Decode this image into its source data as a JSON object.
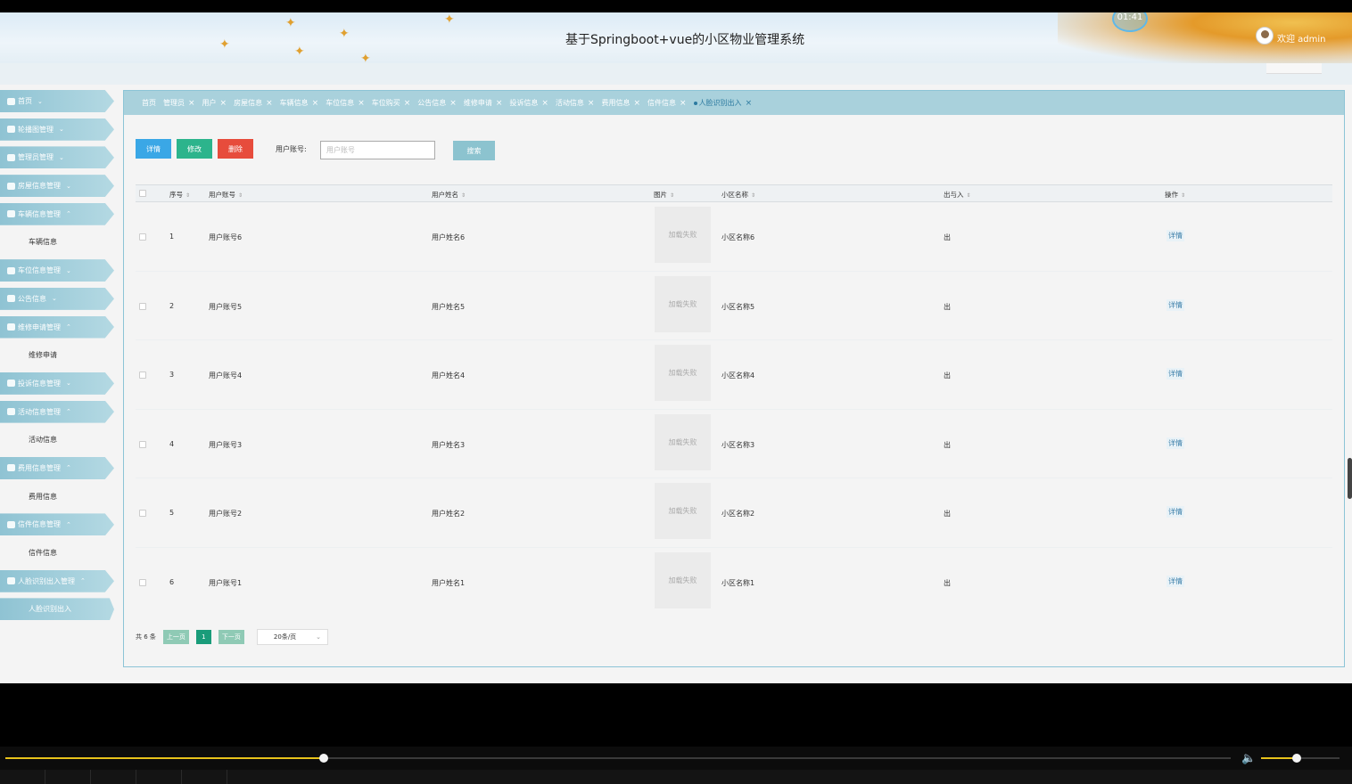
{
  "app": {
    "title": "基于Springboot+vue的小区物业管理系统",
    "clock": "01:41",
    "welcome": "欢迎 admin"
  },
  "colors": {
    "sidebar": "#8fc3d3",
    "tabbar": "#a9d1dc",
    "btn_detail": "#3aa7e6",
    "btn_edit": "#2cb48c",
    "btn_delete": "#e74c3c",
    "btn_search": "#8cc3cf",
    "pager_active": "#1a9c7a",
    "seek": "#e7c21a"
  },
  "sidebar": {
    "items": [
      {
        "type": "menu",
        "label": "首页",
        "icon": "home-icon",
        "arrow": "⌄"
      },
      {
        "type": "menu",
        "label": "轮播图管理",
        "icon": "carousel-icon",
        "arrow": "⌄"
      },
      {
        "type": "menu",
        "label": "管理员管理",
        "icon": "admin-icon",
        "arrow": "⌄"
      },
      {
        "type": "menu",
        "label": "房屋信息管理",
        "icon": "house-icon",
        "arrow": "⌄"
      },
      {
        "type": "menu",
        "label": "车辆信息管理",
        "icon": "car-icon",
        "arrow": "⌃"
      },
      {
        "type": "sub",
        "label": "车辆信息"
      },
      {
        "type": "menu",
        "label": "车位信息管理",
        "icon": "parking-icon",
        "arrow": "⌄"
      },
      {
        "type": "menu",
        "label": "公告信息",
        "icon": "grid-icon",
        "arrow": "⌄"
      },
      {
        "type": "menu",
        "label": "维修申请管理",
        "icon": "repair-icon",
        "arrow": "⌃"
      },
      {
        "type": "sub",
        "label": "维修申请"
      },
      {
        "type": "menu",
        "label": "投诉信息管理",
        "icon": "complaint-icon",
        "arrow": "⌄"
      },
      {
        "type": "menu",
        "label": "活动信息管理",
        "icon": "activity-icon",
        "arrow": "⌃"
      },
      {
        "type": "sub",
        "label": "活动信息"
      },
      {
        "type": "menu",
        "label": "费用信息管理",
        "icon": "fee-icon",
        "arrow": "⌃"
      },
      {
        "type": "sub",
        "label": "费用信息"
      },
      {
        "type": "menu",
        "label": "信件信息管理",
        "icon": "mail-icon",
        "arrow": "⌃"
      },
      {
        "type": "sub",
        "label": "信件信息"
      },
      {
        "type": "menu",
        "label": "人脸识别出入管理",
        "icon": "face-icon",
        "arrow": "⌃"
      },
      {
        "type": "sub",
        "label": "人脸识别出入",
        "active": true
      }
    ]
  },
  "tabs": [
    {
      "label": "首页",
      "closable": false
    },
    {
      "label": "管理员",
      "closable": true
    },
    {
      "label": "用户",
      "closable": true
    },
    {
      "label": "房屋信息",
      "closable": true
    },
    {
      "label": "车辆信息",
      "closable": true
    },
    {
      "label": "车位信息",
      "closable": true
    },
    {
      "label": "车位购买",
      "closable": true
    },
    {
      "label": "公告信息",
      "closable": true
    },
    {
      "label": "维修申请",
      "closable": true
    },
    {
      "label": "投诉信息",
      "closable": true
    },
    {
      "label": "活动信息",
      "closable": true
    },
    {
      "label": "费用信息",
      "closable": true
    },
    {
      "label": "信件信息",
      "closable": true
    },
    {
      "label": "人脸识别出入",
      "closable": true,
      "active": true
    }
  ],
  "toolbar": {
    "detail": "详情",
    "edit": "修改",
    "delete": "删除",
    "search_label": "用户账号:",
    "search_placeholder": "用户账号",
    "search_value": "",
    "search_button": "搜索"
  },
  "table": {
    "columns": [
      "序号",
      "用户账号",
      "用户姓名",
      "图片",
      "小区名称",
      "出与入",
      "操作"
    ],
    "rows": [
      {
        "index": "1",
        "account": "用户账号6",
        "name": "用户姓名6",
        "image": "加载失败",
        "community": "小区名称6",
        "inout": "出",
        "action": "详情"
      },
      {
        "index": "2",
        "account": "用户账号5",
        "name": "用户姓名5",
        "image": "加载失败",
        "community": "小区名称5",
        "inout": "出",
        "action": "详情"
      },
      {
        "index": "3",
        "account": "用户账号4",
        "name": "用户姓名4",
        "image": "加载失败",
        "community": "小区名称4",
        "inout": "出",
        "action": "详情"
      },
      {
        "index": "4",
        "account": "用户账号3",
        "name": "用户姓名3",
        "image": "加载失败",
        "community": "小区名称3",
        "inout": "出",
        "action": "详情"
      },
      {
        "index": "5",
        "account": "用户账号2",
        "name": "用户姓名2",
        "image": "加载失败",
        "community": "小区名称2",
        "inout": "出",
        "action": "详情"
      },
      {
        "index": "6",
        "account": "用户账号1",
        "name": "用户姓名1",
        "image": "加载失败",
        "community": "小区名称1",
        "inout": "出",
        "action": "详情"
      }
    ]
  },
  "pager": {
    "total": "共 6 条",
    "prev": "上一页",
    "page": "1",
    "next": "下一页",
    "size": "20条/页"
  },
  "player": {
    "progress": 0.26,
    "volume": 0.45
  }
}
